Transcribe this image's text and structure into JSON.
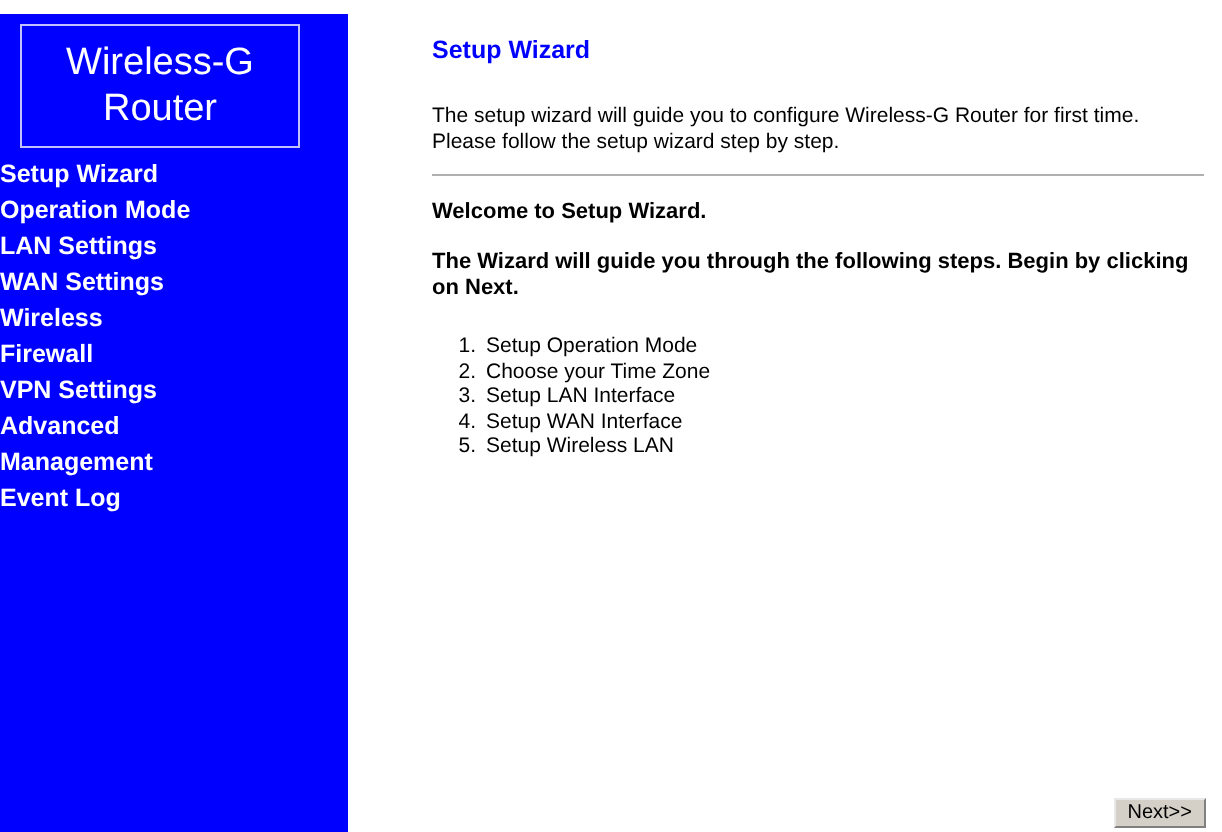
{
  "sidebar": {
    "logo_lines": [
      "Wireless-G",
      "Router"
    ],
    "items": [
      "Setup Wizard",
      "Operation Mode",
      "LAN Settings",
      "WAN Settings",
      "Wireless",
      "Firewall",
      "VPN Settings",
      "Advanced",
      "Management",
      "Event Log"
    ]
  },
  "main": {
    "title": "Setup Wizard",
    "intro": "The setup wizard will guide you to configure Wireless-G Router for first time. Please follow the setup wizard step by step.",
    "welcome": "Welcome to Setup Wizard.",
    "instructions": "The Wizard will guide you through the following steps. Begin by clicking on Next.",
    "steps": [
      {
        "number": "1.",
        "text": "Setup Operation Mode"
      },
      {
        "number": "2.",
        "text": "Choose your Time Zone"
      },
      {
        "number": "3.",
        "text": "Setup LAN Interface"
      },
      {
        "number": "4.",
        "text": "Setup WAN Interface"
      },
      {
        "number": "5.",
        "text": "Setup Wireless LAN"
      }
    ],
    "next_button": "Next>>"
  }
}
